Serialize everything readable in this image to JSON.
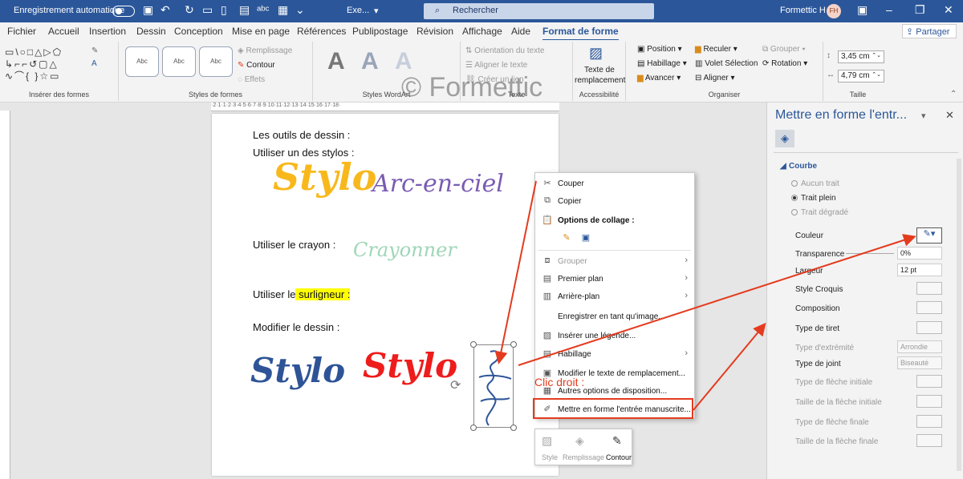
{
  "titlebar": {
    "autosave_label": "Enregistrement automatique",
    "doc_name": "Exe...",
    "search_placeholder": "Rechercher",
    "user_name": "Formettic H",
    "user_initials": "FH"
  },
  "tabs": [
    "Fichier",
    "Accueil",
    "Insertion",
    "Dessin",
    "Conception",
    "Mise en page",
    "Références",
    "Publipostage",
    "Révision",
    "Affichage",
    "Aide",
    "Format de forme"
  ],
  "share_label": "Partager",
  "ribbon": {
    "groups": {
      "insert_shapes": "Insérer des formes",
      "shape_styles": "Styles de formes",
      "wordart_styles": "Styles WordArt",
      "text": "Texte",
      "accessibility": "Accessibilité",
      "arrange": "Organiser",
      "size": "Taille"
    },
    "style_sample": "Abc",
    "fill": "Remplissage",
    "outline": "Contour",
    "effects": "Effets",
    "wordart_letter": "A",
    "text_direction": "Orientation du texte",
    "align_text": "Aligner le texte",
    "create_link": "Créer un lien",
    "alt_text_line1": "Texte de",
    "alt_text_line2": "remplacement",
    "position": "Position",
    "wrap": "Habillage",
    "forward": "Avancer",
    "backward": "Reculer",
    "selection_pane": "Volet Sélection",
    "align": "Aligner",
    "group": "Grouper",
    "rotate": "Rotation",
    "height": "3,45 cm",
    "width": "4,79 cm"
  },
  "watermark": "© Formettic",
  "document": {
    "line1": "Les outils de dessin :",
    "line2": "Utiliser un des stylos :",
    "pen1": "Stylo",
    "pen2": "Arc-en-ciel",
    "line3": "Utiliser le crayon :",
    "pencil": "Crayonner",
    "line4_prefix": "Utiliser le",
    "line4_highlight": " surligneur :",
    "line5": "Modifier le dessin :",
    "ink1": "Stylo",
    "ink2": "Stylo"
  },
  "context_menu": {
    "cut": "Couper",
    "copy": "Copier",
    "paste_options": "Options de collage :",
    "group": "Grouper",
    "bring_front": "Premier plan",
    "send_back": "Arrière-plan",
    "save_image": "Enregistrer en tant qu'image...",
    "insert_caption": "Insérer une légende...",
    "wrap": "Habillage",
    "edit_alt": "Modifier le texte de remplacement...",
    "more_layout": "Autres options de disposition...",
    "format_ink": "Mettre en forme l'entrée manuscrite..."
  },
  "callout": "Clic droit :",
  "mini_toolbar": {
    "style": "Style",
    "fill": "Remplissage",
    "outline": "Contour"
  },
  "pane": {
    "title": "Mettre en forme l'entr...",
    "section": "Courbe",
    "no_line": "Aucun trait",
    "solid_line": "Trait plein",
    "gradient_line": "Trait dégradé",
    "color": "Couleur",
    "transparency": "Transparence",
    "transparency_value": "0%",
    "width": "Largeur",
    "width_value": "12 pt",
    "sketch_style": "Style Croquis",
    "compound": "Composition",
    "dash": "Type de tiret",
    "cap": "Type d'extrémité",
    "cap_value": "Arrondie",
    "join": "Type de joint",
    "join_value": "Biseauté",
    "begin_arrow": "Type de flèche initiale",
    "begin_size": "Taille de la flèche initiale",
    "end_arrow": "Type de flèche finale",
    "end_size": "Taille de la flèche finale"
  },
  "colors": {
    "accent": "#2b579a",
    "annotation": "#e43b1e",
    "ink_blue": "#2e5497",
    "ink_red": "#ee1c1c",
    "ink_yellow": "#f8b81c"
  }
}
